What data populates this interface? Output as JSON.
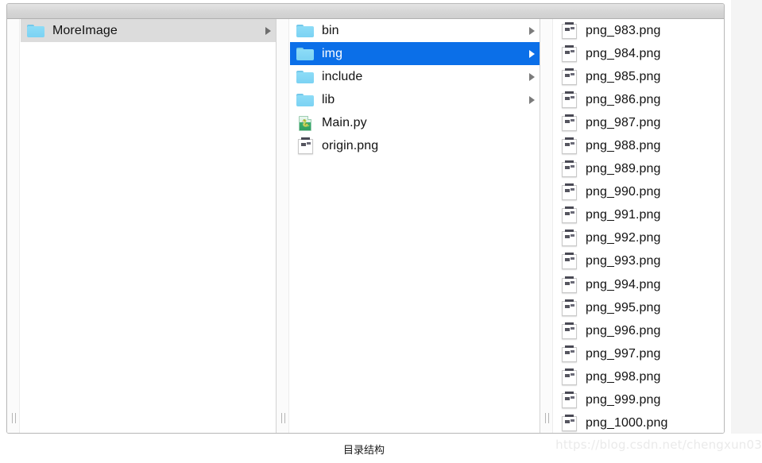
{
  "window": {
    "title": ""
  },
  "columns": [
    {
      "name": "column-one",
      "items": [
        {
          "label": "MoreImage",
          "icon": "folder-icon",
          "kind": "folder",
          "state": "selected-inactive",
          "has_arrow": true
        }
      ]
    },
    {
      "name": "column-two",
      "items": [
        {
          "label": "bin",
          "icon": "folder-icon",
          "kind": "folder",
          "state": "normal",
          "has_arrow": true
        },
        {
          "label": "img",
          "icon": "folder-icon",
          "kind": "folder",
          "state": "selected-active",
          "has_arrow": true
        },
        {
          "label": "include",
          "icon": "folder-icon",
          "kind": "folder",
          "state": "normal",
          "has_arrow": true
        },
        {
          "label": "lib",
          "icon": "folder-icon",
          "kind": "folder",
          "state": "normal",
          "has_arrow": true
        },
        {
          "label": "Main.py",
          "icon": "python-file-icon",
          "kind": "py",
          "state": "normal",
          "has_arrow": false
        },
        {
          "label": "origin.png",
          "icon": "png-thumbnail-icon",
          "kind": "png",
          "state": "normal",
          "has_arrow": false
        }
      ]
    },
    {
      "name": "column-three",
      "items": [
        {
          "label": "png_983.png",
          "icon": "png-thumbnail-icon",
          "kind": "png",
          "state": "normal",
          "has_arrow": false
        },
        {
          "label": "png_984.png",
          "icon": "png-thumbnail-icon",
          "kind": "png",
          "state": "normal",
          "has_arrow": false
        },
        {
          "label": "png_985.png",
          "icon": "png-thumbnail-icon",
          "kind": "png",
          "state": "normal",
          "has_arrow": false
        },
        {
          "label": "png_986.png",
          "icon": "png-thumbnail-icon",
          "kind": "png",
          "state": "normal",
          "has_arrow": false
        },
        {
          "label": "png_987.png",
          "icon": "png-thumbnail-icon",
          "kind": "png",
          "state": "normal",
          "has_arrow": false
        },
        {
          "label": "png_988.png",
          "icon": "png-thumbnail-icon",
          "kind": "png",
          "state": "normal",
          "has_arrow": false
        },
        {
          "label": "png_989.png",
          "icon": "png-thumbnail-icon",
          "kind": "png",
          "state": "normal",
          "has_arrow": false
        },
        {
          "label": "png_990.png",
          "icon": "png-thumbnail-icon",
          "kind": "png",
          "state": "normal",
          "has_arrow": false
        },
        {
          "label": "png_991.png",
          "icon": "png-thumbnail-icon",
          "kind": "png",
          "state": "normal",
          "has_arrow": false
        },
        {
          "label": "png_992.png",
          "icon": "png-thumbnail-icon",
          "kind": "png",
          "state": "normal",
          "has_arrow": false
        },
        {
          "label": "png_993.png",
          "icon": "png-thumbnail-icon",
          "kind": "png",
          "state": "normal",
          "has_arrow": false
        },
        {
          "label": "png_994.png",
          "icon": "png-thumbnail-icon",
          "kind": "png",
          "state": "normal",
          "has_arrow": false
        },
        {
          "label": "png_995.png",
          "icon": "png-thumbnail-icon",
          "kind": "png",
          "state": "normal",
          "has_arrow": false
        },
        {
          "label": "png_996.png",
          "icon": "png-thumbnail-icon",
          "kind": "png",
          "state": "normal",
          "has_arrow": false
        },
        {
          "label": "png_997.png",
          "icon": "png-thumbnail-icon",
          "kind": "png",
          "state": "normal",
          "has_arrow": false
        },
        {
          "label": "png_998.png",
          "icon": "png-thumbnail-icon",
          "kind": "png",
          "state": "normal",
          "has_arrow": false
        },
        {
          "label": "png_999.png",
          "icon": "png-thumbnail-icon",
          "kind": "png",
          "state": "normal",
          "has_arrow": false
        },
        {
          "label": "png_1000.png",
          "icon": "png-thumbnail-icon",
          "kind": "png",
          "state": "normal",
          "has_arrow": false
        }
      ]
    }
  ],
  "caption": "目录结构",
  "watermark": "https://blog.csdn.net/chengxun03",
  "colors": {
    "selection_active": "#0b6fe8",
    "selection_inactive": "#dcdcdc",
    "folder_blue": "#7bd2f3",
    "titlebar": "#d6d6d6",
    "watermark_text": "#eaeaea"
  }
}
